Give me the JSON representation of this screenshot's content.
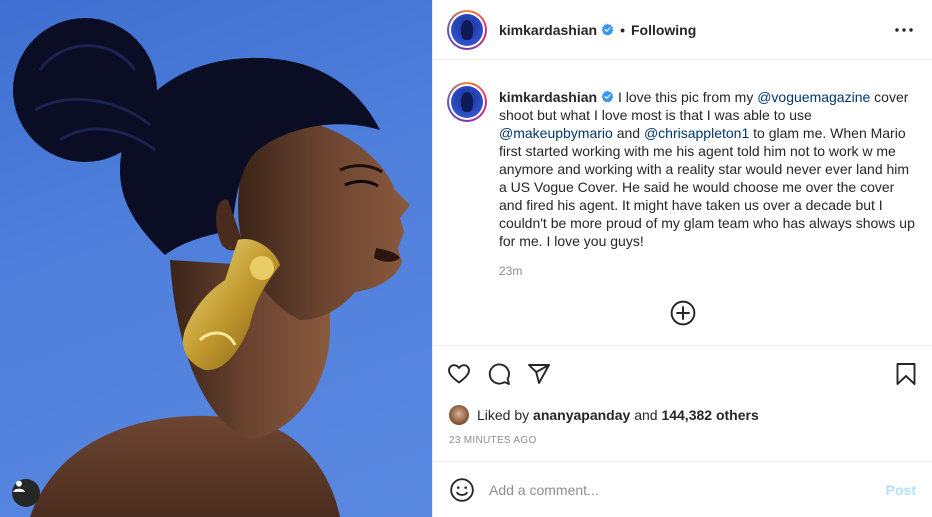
{
  "post": {
    "username": "kimkardashian",
    "separator": "•",
    "follow_status": "Following",
    "caption": {
      "username": "kimkardashian",
      "segments": [
        {
          "type": "text",
          "value": " I love this pic from my "
        },
        {
          "type": "mention",
          "value": "@voguemagazine"
        },
        {
          "type": "text",
          "value": " cover shoot but what I love most is that I was able to use "
        },
        {
          "type": "mention",
          "value": "@makeupbymario"
        },
        {
          "type": "text",
          "value": " and "
        },
        {
          "type": "mention",
          "value": "@chrisappleton1"
        },
        {
          "type": "text",
          "value": " to glam me. When Mario first started working with me his agent told him not to work w me anymore and working with a reality star would never ever land him a US Vogue Cover. He said he would choose me over the cover and fired his agent. It might have taken us over a decade but I couldn't be more proud of my glam team who has always shows up for me. I love you guys!"
        }
      ],
      "time": "23m"
    },
    "likes": {
      "prefix": "Liked by ",
      "user": "ananyapanday",
      "middle": " and ",
      "count": "144,382 others"
    },
    "timestamp": "23 MINUTES AGO",
    "comment_placeholder": "Add a comment...",
    "post_label": "Post"
  },
  "icons": {
    "verified": "verified-badge-icon",
    "more": "more-options-icon",
    "load_more": "plus-circle-icon",
    "like": "heart-icon",
    "comment": "comment-icon",
    "share": "share-icon",
    "save": "bookmark-icon",
    "emoji": "smiley-icon",
    "tag": "user-tag-icon"
  },
  "colors": {
    "mention": "#00376b",
    "post_disabled": "#b2dffc",
    "verified": "#3897f0",
    "meta": "#8e8e8e"
  }
}
